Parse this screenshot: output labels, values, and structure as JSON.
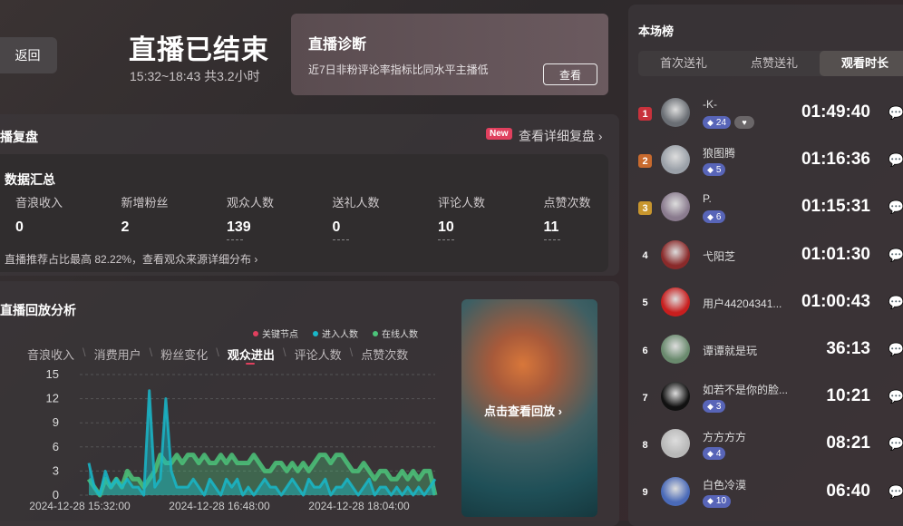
{
  "header": {
    "back_label": "返回",
    "title": "直播已结束",
    "time_range": "15:32~18:43 共3.2小时"
  },
  "diagnosis": {
    "title": "直播诊断",
    "text": "近7日非粉评论率指标比同水平主播低",
    "button": "查看"
  },
  "review": {
    "title": "播复盘",
    "new_badge": "New",
    "detail_link": "查看详细复盘 ›"
  },
  "summary": {
    "title": "数据汇总",
    "metrics": [
      {
        "label": "音浪收入",
        "value": "0"
      },
      {
        "label": "新增粉丝",
        "value": "2"
      },
      {
        "label": "观众人数",
        "value": "139"
      },
      {
        "label": "送礼人数",
        "value": "0"
      },
      {
        "label": "评论人数",
        "value": "10"
      },
      {
        "label": "点赞次数",
        "value": "11"
      }
    ],
    "note": "直播推荐占比最高 82.22%，查看观众来源详细分布 ›"
  },
  "analysis": {
    "title": "直播回放分析",
    "legend": [
      {
        "label": "关键节点",
        "color": "#e0405e"
      },
      {
        "label": "进入人数",
        "color": "#19b7c9"
      },
      {
        "label": "在线人数",
        "color": "#4cc47a"
      }
    ],
    "tabs": [
      "音浪收入",
      "消费用户",
      "粉丝变化",
      "观众进出",
      "评论人数",
      "点赞次数"
    ],
    "separator": "\\",
    "active_tab": 3,
    "replay_label": "点击查看回放 ›"
  },
  "chart_data": {
    "type": "line",
    "y_ticks": [
      "15",
      "12",
      "9",
      "6",
      "3",
      "0"
    ],
    "ylim": [
      0,
      15
    ],
    "x_ticks": [
      "2024-12-28 15:32:00",
      "2024-12-28 16:48:00",
      "2024-12-28 18:04:00"
    ],
    "grid": true,
    "series": [
      {
        "name": "在线人数",
        "color": "#4cc47a",
        "values": [
          2,
          1,
          0,
          2,
          1,
          2,
          1,
          3,
          2,
          2,
          1,
          2,
          3,
          5,
          4,
          4,
          5,
          4,
          5,
          5,
          4,
          5,
          4,
          4,
          5,
          4,
          5,
          4,
          4,
          4,
          5,
          4,
          3,
          3,
          4,
          4,
          3,
          4,
          3,
          4,
          3,
          4,
          5,
          5,
          4,
          5,
          5,
          4,
          3,
          3,
          4,
          3,
          2,
          3,
          3,
          2,
          2,
          3,
          2,
          3,
          2,
          3,
          3,
          0
        ]
      },
      {
        "name": "进入人数",
        "color": "#19b7c9",
        "values": [
          4,
          1,
          0,
          3,
          1,
          2,
          1,
          2,
          1,
          1,
          0,
          13,
          1,
          2,
          12,
          3,
          1,
          1,
          1,
          2,
          1,
          0,
          2,
          1,
          0,
          2,
          1,
          2,
          0,
          1,
          0,
          1,
          2,
          1,
          1,
          0,
          1,
          2,
          1,
          0,
          2,
          1,
          1,
          2,
          0,
          1,
          1,
          2,
          1,
          0,
          1,
          2,
          0,
          1,
          1,
          0,
          1,
          0,
          1,
          0,
          1,
          0,
          1,
          2
        ]
      }
    ]
  },
  "ranking": {
    "title": "本场榜",
    "tabs": [
      "首次送礼",
      "点赞送礼",
      "观看时长"
    ],
    "active_tab": 2,
    "rows": [
      {
        "rank": "1",
        "name": "-K-",
        "level": "24",
        "duration": "01:49:40",
        "badge_color": "#c8323c",
        "avatar": "#6a6e74",
        "heart": "♥"
      },
      {
        "rank": "2",
        "name": "狼图腾",
        "level": "5",
        "duration": "01:16:36",
        "badge_color": "#c86a2e",
        "avatar": "#9aa0a8"
      },
      {
        "rank": "3",
        "name": "P.",
        "level": "6",
        "duration": "01:15:31",
        "badge_color": "#c8962e",
        "avatar": "#8a7b8e"
      },
      {
        "rank": "4",
        "name": "弋阳芝",
        "level": "",
        "duration": "01:01:30",
        "badge_color": "",
        "avatar": "#8a2a2a"
      },
      {
        "rank": "5",
        "name": "用户44204341...",
        "level": "",
        "duration": "01:00:43",
        "badge_color": "",
        "avatar": "#c81e1e"
      },
      {
        "rank": "6",
        "name": "谭谭就是玩",
        "level": "",
        "duration": "36:13",
        "badge_color": "",
        "avatar": "#6a8a6e"
      },
      {
        "rank": "7",
        "name": "如若不是你的脸...",
        "level": "3",
        "duration": "10:21",
        "badge_color": "",
        "avatar": "#111111"
      },
      {
        "rank": "8",
        "name": "方方方方",
        "level": "4",
        "duration": "08:21",
        "badge_color": "",
        "avatar": "#b8b8b8"
      },
      {
        "rank": "9",
        "name": "白色冷漠",
        "level": "10",
        "duration": "06:40",
        "badge_color": "",
        "avatar": "#4a6ab8"
      }
    ]
  }
}
